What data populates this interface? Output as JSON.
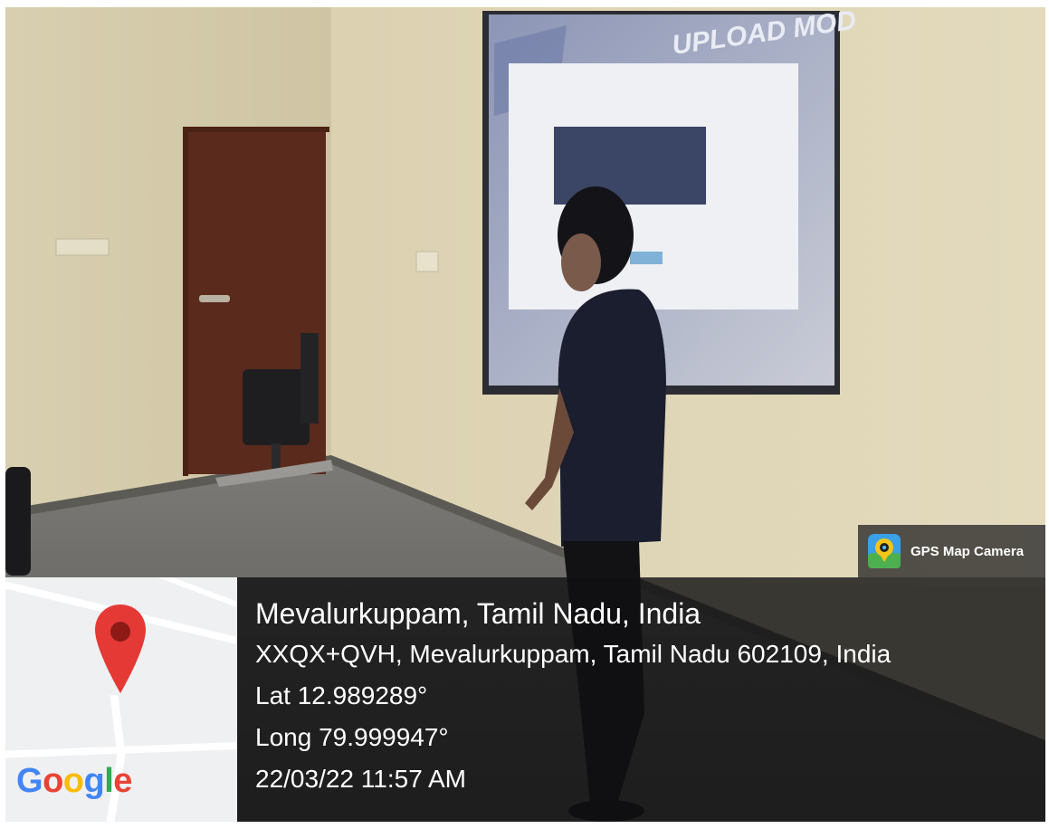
{
  "watermark": {
    "app_name": "GPS Map Camera",
    "app_icon": "gps-map-camera-icon"
  },
  "map": {
    "brand_letters": [
      {
        "ch": "G",
        "color": "#4285F4"
      },
      {
        "ch": "o",
        "color": "#EA4335"
      },
      {
        "ch": "o",
        "color": "#FBBC05"
      },
      {
        "ch": "g",
        "color": "#4285F4"
      },
      {
        "ch": "l",
        "color": "#34A853"
      },
      {
        "ch": "e",
        "color": "#EA4335"
      }
    ],
    "pin_icon": "map-pin-icon",
    "pin_color": "#E53935"
  },
  "location": {
    "place": "Mevalurkuppam, Tamil Nadu, India",
    "address": "XXQX+QVH, Mevalurkuppam, Tamil Nadu 602109, India",
    "latitude": "Lat 12.989289°",
    "longitude": "Long 79.999947°",
    "datetime": "22/03/22 11:57 AM"
  },
  "projector_screen": {
    "slide_heading": "UPLOAD MOD"
  }
}
